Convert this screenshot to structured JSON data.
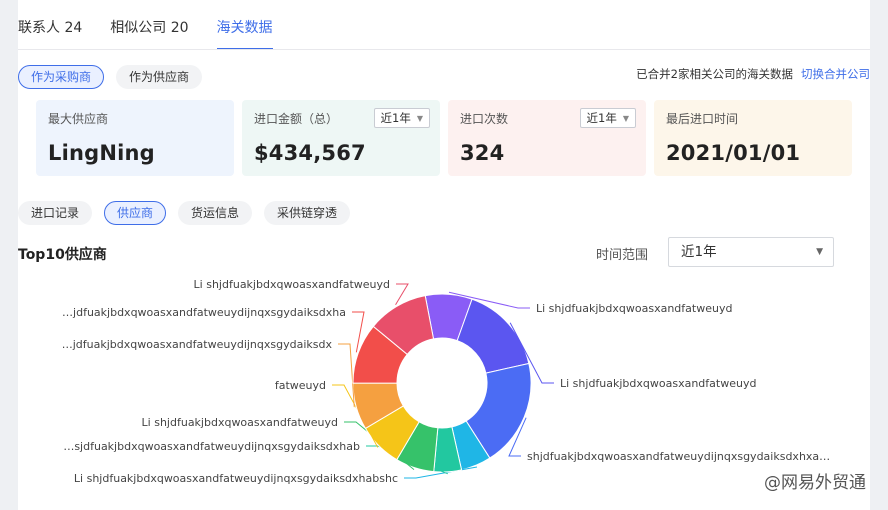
{
  "tabs": [
    {
      "label": "联系人 24",
      "active": false
    },
    {
      "label": "相似公司 20",
      "active": false
    },
    {
      "label": "海关数据",
      "active": true
    }
  ],
  "role_buttons": [
    {
      "label": "作为采购商",
      "active": true
    },
    {
      "label": "作为供应商",
      "active": false
    }
  ],
  "merge_note": {
    "text": "已合并2家相关公司的海关数据",
    "link": "切换合并公司"
  },
  "cards": [
    {
      "label": "最大供应商",
      "value": "LingNing",
      "select": null,
      "bg": "#eef4fd"
    },
    {
      "label": "进口金额（总）",
      "value": "$434,567",
      "select": "近1年",
      "bg": "#eef7f5"
    },
    {
      "label": "进口次数",
      "value": "324",
      "select": "近1年",
      "bg": "#fdf1f0"
    },
    {
      "label": "最后进口时间",
      "value": "2021/01/01",
      "select": null,
      "bg": "#fdf6ea"
    }
  ],
  "sub_tabs": [
    {
      "label": "进口记录",
      "active": false
    },
    {
      "label": "供应商",
      "active": true
    },
    {
      "label": "货运信息",
      "active": false
    },
    {
      "label": "采供链穿透",
      "active": false
    }
  ],
  "section_title": "Top10供应商",
  "time_range": {
    "label": "时间范围",
    "value": "近1年"
  },
  "chart_data": {
    "type": "pie",
    "donut": true,
    "series": [
      {
        "label": "Li shjdfuakjbdxqwoasxandfatweuyd",
        "value": 8.5,
        "color": "#8a5cf6"
      },
      {
        "label": "Li shjdfuakjbdxqwoasxandfatweuyd",
        "value": 16,
        "color": "#5b56f0"
      },
      {
        "label": "shjdfuakjbdxqwoasxandfatweuydijnqxsgydaiksdxhxa…",
        "value": 19.5,
        "color": "#4b6cf4"
      },
      {
        "label": "Li shjdfuakjbdxqwoasxandfatweuydijnqxsgydaiksdxhabshc",
        "value": 5.5,
        "color": "#1fb6e6"
      },
      {
        "label": "…sjdfuakjbdxqwoasxandfatweuydijnqxsgydaiksdxhab",
        "value": 5,
        "color": "#22c8a0"
      },
      {
        "label": "Li shjdfuakjbdxqwoasxandfatweuyd",
        "value": 7,
        "color": "#36c26a"
      },
      {
        "label": "fatweuyd",
        "value": 8,
        "color": "#f5c518"
      },
      {
        "label": "…jdfuakjbdxqwoasxandfatweuydijnqxsgydaiksdx",
        "value": 8.5,
        "color": "#f5a040"
      },
      {
        "label": "…jdfuakjbdxqwoasxandfatweuydijnqxsgydaiksdxha",
        "value": 11,
        "color": "#f24e4a"
      },
      {
        "label": "Li shjdfuakjbdxqwoasxandfatweuyd",
        "value": 11,
        "color": "#e84f6a"
      }
    ]
  },
  "watermark": "@网易外贸通"
}
